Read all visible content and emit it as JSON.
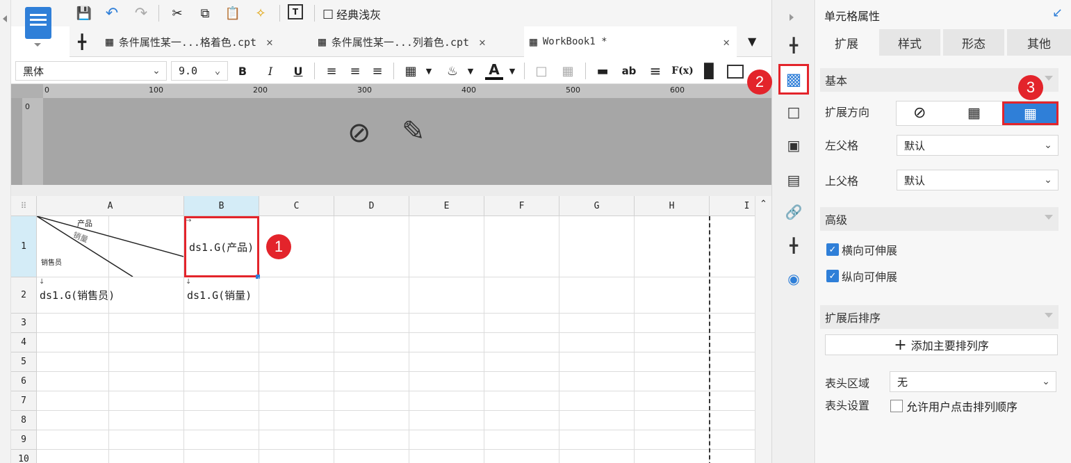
{
  "toolbar": {
    "theme_label": "经典浅灰"
  },
  "tabs": [
    {
      "label": "条件属性某一...格着色.cpt"
    },
    {
      "label": "条件属性某一...列着色.cpt"
    },
    {
      "label": "WorkBook1 *"
    }
  ],
  "format": {
    "font_name": "黑体",
    "font_size": "9.0",
    "bold": "B",
    "italic": "I",
    "underline": "U",
    "font_color_glyph": "A",
    "text_icon": "ab",
    "formula_icon": "F(x)"
  },
  "ruler": {
    "ticks": [
      "0",
      "100",
      "200",
      "300",
      "400",
      "500",
      "600"
    ],
    "vtick": "0"
  },
  "grid": {
    "columns": [
      "A",
      "B",
      "C",
      "D",
      "E",
      "F",
      "G",
      "H",
      "I"
    ],
    "rows": [
      "1",
      "2",
      "3",
      "4",
      "5",
      "6",
      "7",
      "8",
      "9",
      "10"
    ],
    "a1_diag": {
      "top": "产品",
      "mid": "销量",
      "bottom": "销售员"
    },
    "b1": "ds1.G(产品)",
    "a2": "ds1.G(销售员)",
    "b2": "ds1.G(销量)"
  },
  "panel": {
    "title": "单元格属性",
    "tabs": [
      "扩展",
      "样式",
      "形态",
      "其他"
    ],
    "basic_section": "基本",
    "expand_direction_label": "扩展方向",
    "left_parent_label": "左父格",
    "left_parent_value": "默认",
    "top_parent_label": "上父格",
    "top_parent_value": "默认",
    "advanced_section": "高级",
    "horizontal_expand": "横向可伸展",
    "vertical_expand": "纵向可伸展",
    "sort_section": "扩展后排序",
    "add_sort_button": "添加主要排列序",
    "header_area_label": "表头区域",
    "header_area_value": "无",
    "header_settings_label": "表头设置",
    "allow_user_sort": "允许用户点击排列顺序"
  },
  "badges": [
    "1",
    "2",
    "3"
  ],
  "colors": {
    "accent": "#2f7fd8",
    "badge": "#e3242b",
    "selection": "#e3242b"
  }
}
